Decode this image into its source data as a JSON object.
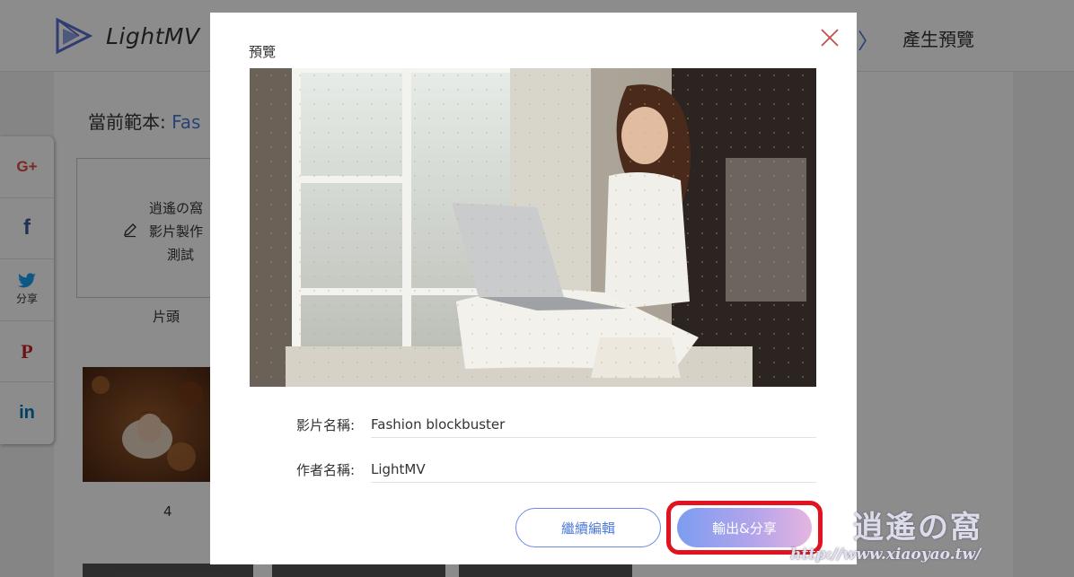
{
  "app": {
    "logo_text": "LightMV",
    "step_arrow": "〉",
    "step_preview": "產生預覽",
    "template_label": "當前範本: ",
    "template_name": "Fas",
    "intro_lines": [
      "逍遙の窩",
      "影片製作",
      "測試"
    ],
    "intro_caption": "片頭",
    "thumb_caption": "4"
  },
  "social": {
    "items": [
      {
        "icon": "google-plus-icon",
        "glyph": "G+"
      },
      {
        "icon": "facebook-icon",
        "glyph": "f"
      },
      {
        "icon": "twitter-icon",
        "glyph": "",
        "label": "分享"
      },
      {
        "icon": "pinterest-icon",
        "glyph": "P"
      },
      {
        "icon": "linkedin-icon",
        "glyph": "in"
      }
    ]
  },
  "modal": {
    "title": "預覽",
    "name_label": "影片名稱:",
    "name_value": "Fashion blockbuster",
    "author_label": "作者名稱:",
    "author_value": "LightMV",
    "continue_label": "繼續編輯",
    "export_label": "輸出&分享"
  },
  "watermark": {
    "logo": "逍遙の窩",
    "url": "http://www.xiaoyao.tw/"
  },
  "colors": {
    "accent": "#4e7bd8",
    "highlight": "#e3121f",
    "google": "#dd4b39",
    "facebook": "#3b5998",
    "twitter": "#1da1f2",
    "pinterest": "#cb2027",
    "linkedin": "#0077b5"
  }
}
